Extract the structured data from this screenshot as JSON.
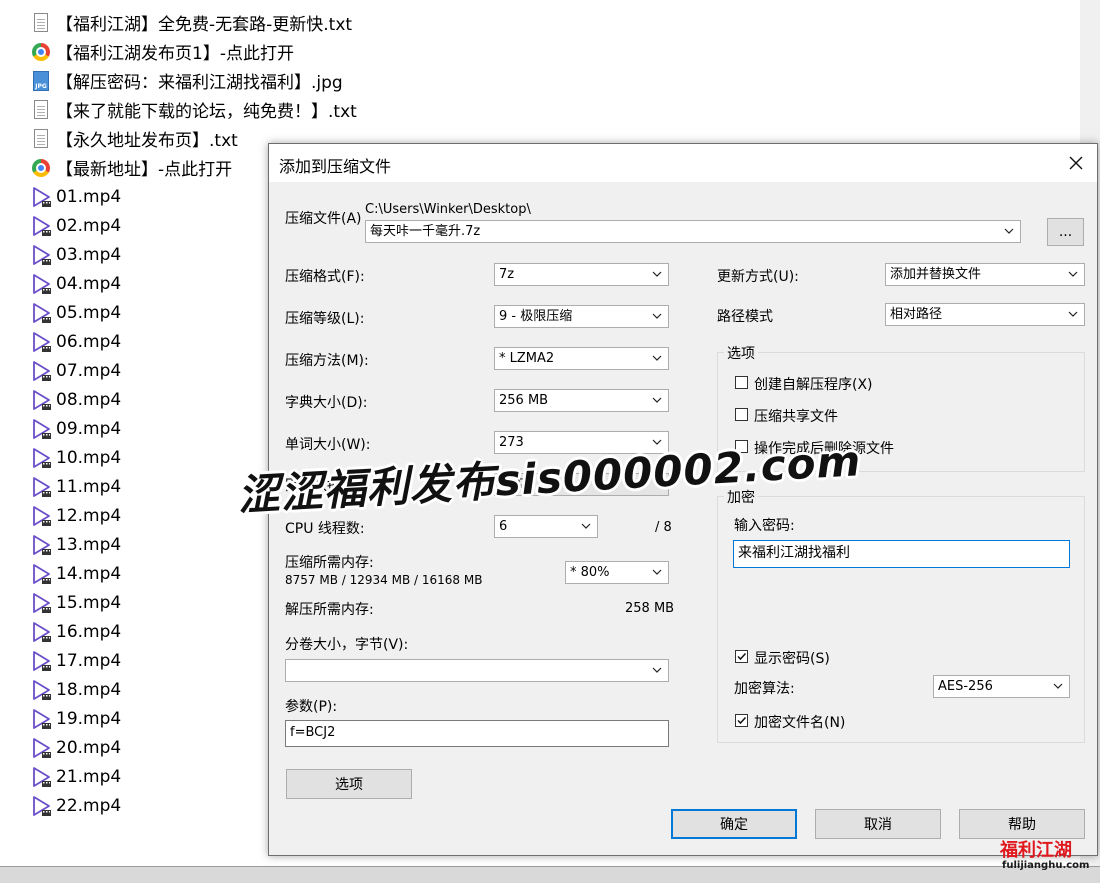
{
  "files": [
    {
      "name": "【福利江湖】全免费-无套路-更新快.txt",
      "icon": "text-file-icon",
      "type": "txt"
    },
    {
      "name": "【福利江湖发布页1】-点此打开",
      "icon": "chrome-icon",
      "type": "chrome"
    },
    {
      "name": "【解压密码：来福利江湖找福利】.jpg",
      "icon": "jpg-file-icon",
      "type": "jpg"
    },
    {
      "name": "【来了就能下载的论坛，纯免费！】.txt",
      "icon": "text-file-icon",
      "type": "txt"
    },
    {
      "name": "【永久地址发布页】.txt",
      "icon": "text-file-icon",
      "type": "txt"
    },
    {
      "name": "【最新地址】-点此打开",
      "icon": "chrome-icon",
      "type": "chrome"
    },
    {
      "name": "01.mp4",
      "icon": "video-file-icon",
      "type": "mp4"
    },
    {
      "name": "02.mp4",
      "icon": "video-file-icon",
      "type": "mp4"
    },
    {
      "name": "03.mp4",
      "icon": "video-file-icon",
      "type": "mp4"
    },
    {
      "name": "04.mp4",
      "icon": "video-file-icon",
      "type": "mp4"
    },
    {
      "name": "05.mp4",
      "icon": "video-file-icon",
      "type": "mp4"
    },
    {
      "name": "06.mp4",
      "icon": "video-file-icon",
      "type": "mp4"
    },
    {
      "name": "07.mp4",
      "icon": "video-file-icon",
      "type": "mp4"
    },
    {
      "name": "08.mp4",
      "icon": "video-file-icon",
      "type": "mp4"
    },
    {
      "name": "09.mp4",
      "icon": "video-file-icon",
      "type": "mp4"
    },
    {
      "name": "10.mp4",
      "icon": "video-file-icon",
      "type": "mp4"
    },
    {
      "name": "11.mp4",
      "icon": "video-file-icon",
      "type": "mp4"
    },
    {
      "name": "12.mp4",
      "icon": "video-file-icon",
      "type": "mp4"
    },
    {
      "name": "13.mp4",
      "icon": "video-file-icon",
      "type": "mp4"
    },
    {
      "name": "14.mp4",
      "icon": "video-file-icon",
      "type": "mp4"
    },
    {
      "name": "15.mp4",
      "icon": "video-file-icon",
      "type": "mp4"
    },
    {
      "name": "16.mp4",
      "icon": "video-file-icon",
      "type": "mp4"
    },
    {
      "name": "17.mp4",
      "icon": "video-file-icon",
      "type": "mp4"
    },
    {
      "name": "18.mp4",
      "icon": "video-file-icon",
      "type": "mp4"
    },
    {
      "name": "19.mp4",
      "icon": "video-file-icon",
      "type": "mp4"
    },
    {
      "name": "20.mp4",
      "icon": "video-file-icon",
      "type": "mp4"
    },
    {
      "name": "21.mp4",
      "icon": "video-file-icon",
      "type": "mp4"
    },
    {
      "name": "22.mp4",
      "icon": "video-file-icon",
      "type": "mp4"
    }
  ],
  "dialog": {
    "title": "添加到压缩文件",
    "close_icon": "close-icon",
    "archive": {
      "label": "压缩文件(A)",
      "path": "C:\\Users\\Winker\\Desktop\\",
      "filename": "每天咔一千毫升.7z",
      "browse_label": "..."
    },
    "format": {
      "label": "压缩格式(F):",
      "value": "7z"
    },
    "level": {
      "label": "压缩等级(L):",
      "value": "9 - 极限压缩"
    },
    "method": {
      "label": "压缩方法(M):",
      "value": "* LZMA2"
    },
    "dictionary": {
      "label": "字典大小(D):",
      "value": "256 MB"
    },
    "word_size": {
      "label": "单词大小(W):",
      "value": "273"
    },
    "solid_block": {
      "label": "固实数据大小",
      "value": "固实"
    },
    "threads": {
      "label": "CPU 线程数:",
      "value": "6",
      "max": "/ 8"
    },
    "compress_memory": {
      "label": "压缩所需内存:",
      "detail": "8757 MB / 12934 MB / 16168 MB",
      "value": "* 80%"
    },
    "decompress_memory": {
      "label": "解压所需内存:",
      "value": "258 MB"
    },
    "volume": {
      "label": "分卷大小，字节(V):",
      "value": ""
    },
    "params": {
      "label": "参数(P):",
      "value": "f=BCJ2"
    },
    "options_button": "选项",
    "update_mode": {
      "label": "更新方式(U):",
      "value": "添加并替换文件"
    },
    "path_mode": {
      "label": "路径模式",
      "value": "相对路径"
    },
    "options_group": {
      "title": "选项",
      "items": [
        {
          "label": "创建自解压程序(X)",
          "checked": false
        },
        {
          "label": "压缩共享文件",
          "checked": false
        },
        {
          "label": "操作完成后删除源文件",
          "checked": false
        }
      ]
    },
    "encryption": {
      "title": "加密",
      "password_label": "输入密码:",
      "password": "来福利江湖找福利",
      "show_password": {
        "label": "显示密码(S)",
        "checked": true
      },
      "algorithm_label": "加密算法:",
      "algorithm": "AES-256",
      "encrypt_names": {
        "label": "加密文件名(N)",
        "checked": true
      }
    },
    "buttons": {
      "ok": "确定",
      "cancel": "取消",
      "help": "帮助"
    }
  },
  "watermark": {
    "text": "涩涩福利发布sis000002.com"
  },
  "logo": {
    "main": "福利江湖",
    "sub": "fulijianghu.com"
  },
  "colors": {
    "accent": "#0078d7",
    "video_icon": "#6b4fc9",
    "logo_red": "#e0191f"
  }
}
